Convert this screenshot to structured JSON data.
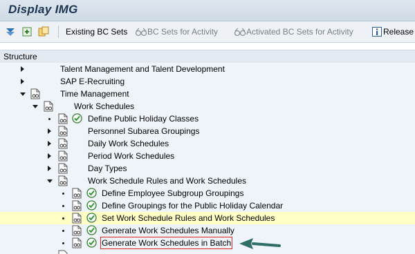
{
  "window": {
    "title": "Display IMG"
  },
  "toolbar": {
    "existing_bc_sets": "Existing BC Sets",
    "bc_sets_for_activity": "BC Sets for Activity",
    "activated_bc_sets_for_activity": "Activated BC Sets for Activity",
    "release": "Release"
  },
  "structure": {
    "header": "Structure",
    "items": [
      {
        "label": "Talent Management and Talent Development"
      },
      {
        "label": "SAP E-Recruiting"
      },
      {
        "label": "Time Management"
      },
      {
        "label": "Work Schedules"
      },
      {
        "label": "Define Public Holiday Classes"
      },
      {
        "label": "Personnel Subarea Groupings"
      },
      {
        "label": "Daily Work Schedules"
      },
      {
        "label": "Period Work Schedules"
      },
      {
        "label": "Day Types"
      },
      {
        "label": "Work Schedule Rules and Work Schedules"
      },
      {
        "label": "Define Employee Subgroup Groupings"
      },
      {
        "label": "Define Groupings for the Public Holiday Calendar"
      },
      {
        "label": "Set Work Schedule Rules and Work Schedules"
      },
      {
        "label": "Generate Work Schedules Manually"
      },
      {
        "label": "Generate Work Schedules in Batch"
      }
    ]
  },
  "colors": {
    "highlight": "#ffffc6",
    "selection_box": "#d22222",
    "pointer_arrow": "#2f6f66"
  }
}
